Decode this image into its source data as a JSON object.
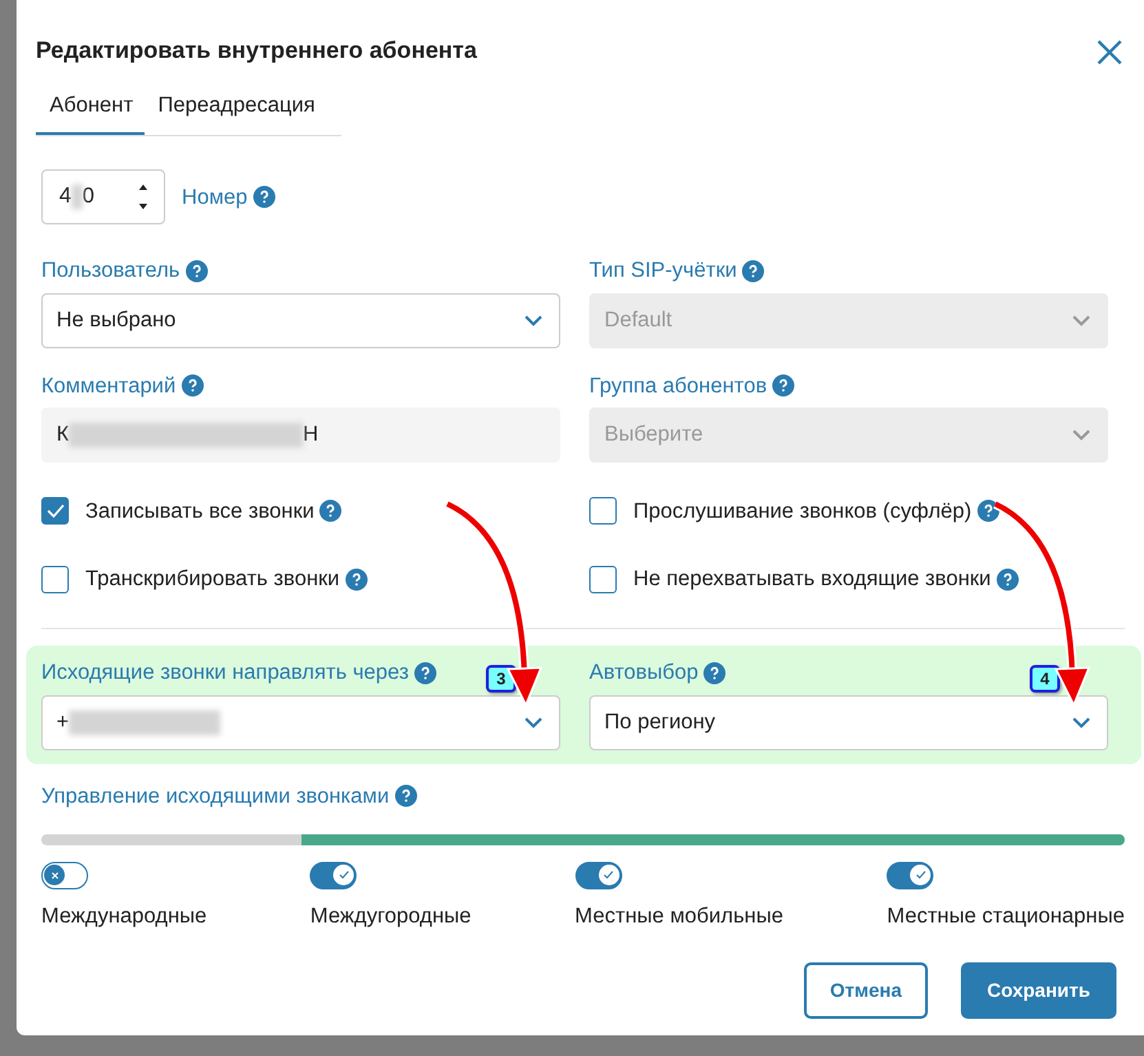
{
  "dialog": {
    "title": "Редактировать внутреннего абонента"
  },
  "tabs": [
    {
      "label": "Абонент",
      "selected": true
    },
    {
      "label": "Переадресация",
      "selected": false
    }
  ],
  "number": {
    "label": "Номер",
    "value": "4",
    "value_end": "0",
    "redacted": true
  },
  "fields": [
    {
      "label": "Пользователь",
      "value": "Не выбрано",
      "kind": "select",
      "disabled": false
    },
    {
      "label": "Тип SIP-учётки",
      "value": "Default",
      "kind": "select",
      "disabled": true
    },
    {
      "label": "Комментарий",
      "value": "К",
      "value_end": "Н",
      "redacted": true,
      "kind": "text",
      "disabled": false
    },
    {
      "label": "Группа абонентов",
      "placeholder": "Выберите",
      "kind": "select",
      "disabled": true
    }
  ],
  "checkboxes": [
    {
      "label": "Записывать все звонки",
      "checked": true
    },
    {
      "label": "Прослушивание звонков (суфлёр)",
      "checked": false
    },
    {
      "label": "Транскрибировать звонки",
      "checked": false
    },
    {
      "label": "Не перехватывать входящие звонки",
      "checked": false
    }
  ],
  "routing": [
    {
      "label": "Исходящие звонки направлять через",
      "value": "+",
      "redacted": true,
      "annotation": "3"
    },
    {
      "label": "Автовыбор",
      "value": "По региону",
      "annotation": "4"
    }
  ],
  "outgoing": {
    "label": "Управление исходящими звонками",
    "level": 0.76,
    "toggles": [
      {
        "label": "Международные",
        "on": false
      },
      {
        "label": "Междугородные",
        "on": true
      },
      {
        "label": "Местные мобильные",
        "on": true
      },
      {
        "label": "Местные стационарные",
        "on": true
      }
    ]
  },
  "buttons": [
    {
      "label": "Отмена",
      "kind": "secondary"
    },
    {
      "label": "Сохранить",
      "kind": "primary"
    }
  ]
}
